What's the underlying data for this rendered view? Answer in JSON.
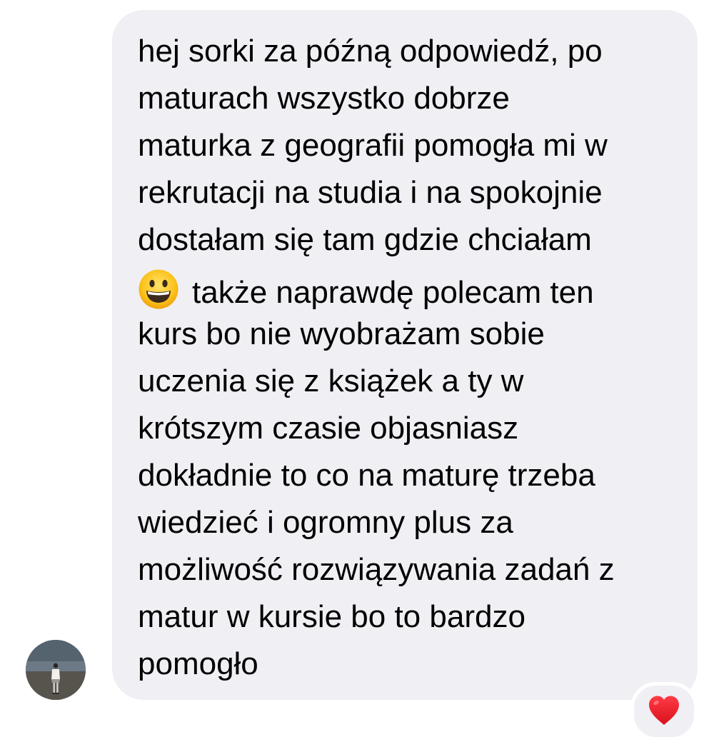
{
  "message": {
    "lines": [
      "hej sorki za późną odpowiedź, po",
      "maturach wszystko dobrze",
      "maturka z geografii pomogła mi w",
      "rekrutacji na studia i na spokojnie",
      "dostałam się tam gdzie chciałam",
      "także naprawdę polecam ten",
      "kurs bo nie wyobrażam sobie",
      "uczenia się z książek a ty w",
      "krótszym czasie objasniasz",
      "dokładnie to co na maturę trzeba",
      "wiedzieć i ogromny plus za",
      "możliwość rozwiązywania zadań z",
      "matur w kursie bo to bardzo",
      "pomogło"
    ],
    "emoji": "grinning-face-emoji",
    "bubble_color": "#efeff4"
  },
  "reaction": {
    "icon": "red-heart-icon",
    "color": "#e8232f"
  },
  "avatar": {
    "icon": "sender-avatar"
  }
}
